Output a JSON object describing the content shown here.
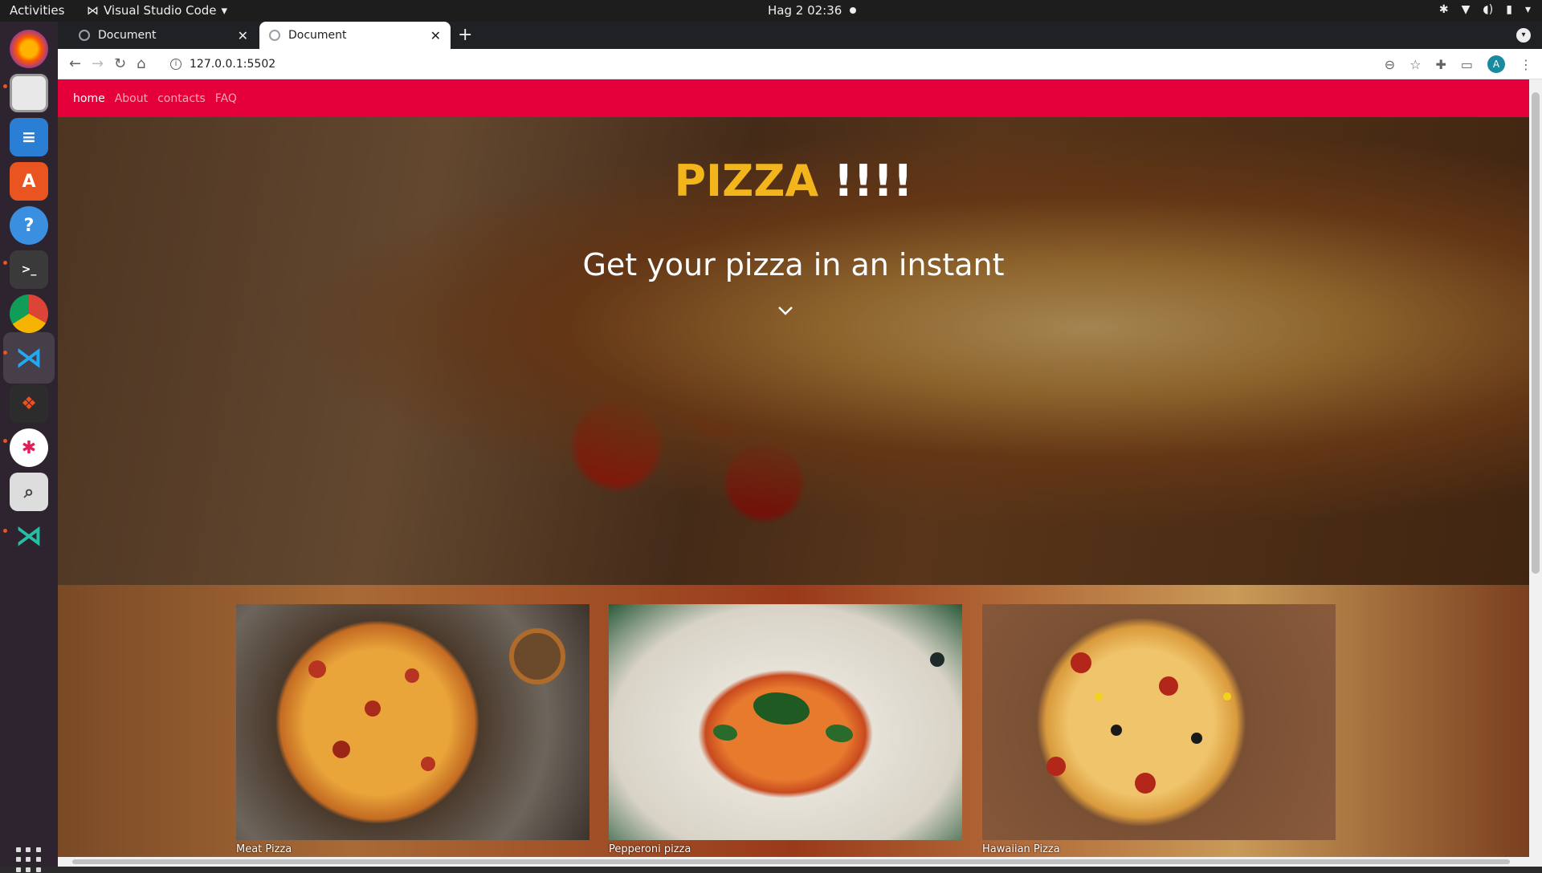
{
  "system": {
    "activities": "Activities",
    "app_name": "Visual Studio Code",
    "clock": "Hag 2  02:36"
  },
  "dock": {
    "items": [
      "firefox-icon",
      "files-icon",
      "writer-icon",
      "software-icon",
      "help-icon",
      "terminal-icon",
      "chrome-icon",
      "vscode-icon",
      "figma-icon",
      "slack-icon",
      "magnifier-icon",
      "vscode-insiders-icon"
    ]
  },
  "browser": {
    "tabs": [
      {
        "title": "Document"
      },
      {
        "title": "Document"
      }
    ],
    "url": "127.0.0.1:5502",
    "profile_initial": "A"
  },
  "site": {
    "nav": [
      "home",
      "About",
      "contacts",
      "FAQ"
    ],
    "hero_title_word": "PIZZA",
    "hero_title_bang": " !!!!",
    "hero_subtitle": "Get your pizza in an instant",
    "cards": [
      {
        "label": "Meat Pizza"
      },
      {
        "label": "Pepperoni pizza"
      },
      {
        "label": "Hawaiian Pizza"
      }
    ]
  },
  "colors": {
    "nav_bg": "#e5003b",
    "title_accent": "#f2b51b"
  }
}
